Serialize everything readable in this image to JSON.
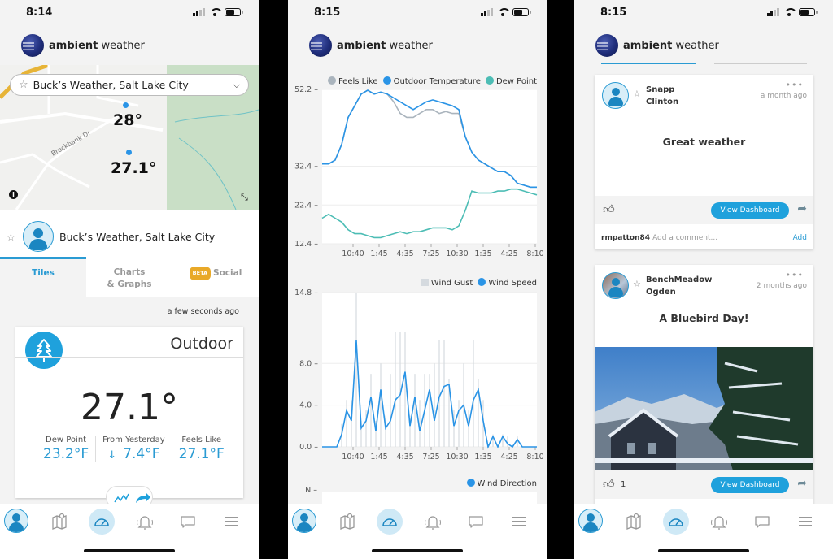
{
  "brand": {
    "bold": "ambient",
    "light": " weather"
  },
  "screens": [
    {
      "status_time": "8:14",
      "map": {
        "street_label": "Brockbank Dr",
        "pins": [
          {
            "temp": "28°"
          },
          {
            "temp": "27.1°"
          }
        ],
        "info_icon": "i",
        "expand_icon": "⤡"
      },
      "station_select": {
        "star_icon": "☆",
        "value": "Buck’s Weather, Salt Lake City",
        "chevron_icon": "⌄"
      },
      "owner": {
        "star_icon": "☆",
        "name": "Buck’s Weather, Salt Lake City"
      },
      "tabs": [
        {
          "label": "Tiles",
          "active": true
        },
        {
          "label_line1": "Charts",
          "label_line2": "& Graphs"
        },
        {
          "badge": "BETA",
          "label": "Social"
        }
      ],
      "updated": "a few seconds ago",
      "tile": {
        "title": "Outdoor",
        "temperature": "27.1°",
        "stats": [
          {
            "label": "Dew Point",
            "value": "23.2°F"
          },
          {
            "label": "From Yesterday",
            "arrow": "↓",
            "value": "7.4°F"
          },
          {
            "label": "Feels Like",
            "value": "27.1°F"
          }
        ]
      }
    },
    {
      "status_time": "8:15",
      "wind_direction_legend": "Wind Direction",
      "wind_direction_first_tick": "N"
    },
    {
      "status_time": "8:15",
      "posts": [
        {
          "user_line1": "Snapp",
          "user_line2": "Clinton",
          "time": "a month ago",
          "more": "•••",
          "message": "Great weather",
          "likes": "",
          "button": "View Dashboard",
          "comment_user": "rmpatton84",
          "comment_placeholder": "Add a comment...",
          "comment_add": "Add"
        },
        {
          "user_line1": "BenchMeadow",
          "user_line2": "Ogden",
          "time": "2 months ago",
          "more": "•••",
          "message": "A Bluebird Day!",
          "likes": "1",
          "button": "View Dashboard"
        }
      ]
    }
  ],
  "nav": [
    "profile",
    "map",
    "dashboard",
    "alerts",
    "messages",
    "menu"
  ],
  "colors": {
    "accent": "#1fa1dc",
    "temp_line": "#2a94e6",
    "dew_line": "#4dbdb5",
    "feels_line": "#aab4bd",
    "gust": "#d5dadf",
    "beta": "#e9a928"
  },
  "chart_data": [
    {
      "type": "line",
      "title": "",
      "legend": [
        "Feels Like",
        "Outdoor Temperature",
        "Dew Point"
      ],
      "legend_position": "top-right",
      "x_ticks": [
        "10:40",
        "1:45",
        "4:35",
        "7:25",
        "10:30",
        "1:35",
        "4:25",
        "8:10"
      ],
      "y_ticks": [
        "12.4",
        "22.4",
        "32.4",
        "52.2"
      ],
      "ylim": [
        12.4,
        52.2
      ],
      "grid": true,
      "series": [
        {
          "name": "Outdoor Temperature",
          "values": [
            33,
            33,
            34,
            38,
            45,
            48,
            51,
            52,
            51,
            51.5,
            51,
            50,
            49,
            48,
            47,
            48,
            49,
            49.5,
            49,
            48.5,
            48,
            47,
            40,
            36,
            34,
            33,
            32,
            31,
            31,
            30,
            28,
            27.5,
            27,
            27
          ]
        },
        {
          "name": "Feels Like",
          "values": [
            33,
            33,
            34,
            38,
            45,
            48,
            51,
            52,
            51,
            51.5,
            51,
            49,
            46,
            45,
            45,
            46,
            47,
            47,
            46,
            46.5,
            46,
            46,
            40,
            36,
            34,
            33,
            32,
            31,
            31,
            30,
            28,
            27.5,
            27,
            27
          ]
        },
        {
          "name": "Dew Point",
          "values": [
            19,
            20,
            19,
            18,
            16,
            15,
            15,
            14.5,
            14,
            14,
            14.5,
            15,
            15.5,
            15,
            15.5,
            15.5,
            16,
            16.5,
            16.5,
            16.5,
            16,
            17,
            21,
            26,
            25.5,
            25.5,
            25.5,
            26,
            26,
            26.5,
            26.5,
            26,
            25.5,
            25
          ]
        }
      ]
    },
    {
      "type": "bar",
      "title": "",
      "legend": [
        "Wind Gust",
        "Wind Speed"
      ],
      "legend_position": "top-right",
      "x_ticks": [
        "10:40",
        "1:45",
        "4:35",
        "7:25",
        "10:30",
        "1:35",
        "4:25",
        "8:10"
      ],
      "y_ticks": [
        "0.0",
        "4.0",
        "8.0",
        "14.8"
      ],
      "ylim": [
        0,
        14.8
      ],
      "grid": true,
      "series": [
        {
          "name": "Wind Speed",
          "values": [
            0,
            0,
            0,
            0,
            1.2,
            3.5,
            2.5,
            10.2,
            1.8,
            2.5,
            4.8,
            1.5,
            5.5,
            1.8,
            2.5,
            4.5,
            5,
            7.2,
            2,
            4.8,
            1.5,
            3.5,
            5.5,
            2.5,
            4.8,
            5.8,
            6,
            2,
            3.5,
            4,
            2,
            4.5,
            5.5,
            2.5,
            0,
            1,
            0,
            1,
            0.3,
            0,
            0.7,
            0,
            0,
            0,
            0
          ]
        },
        {
          "name": "Wind Gust",
          "values": [
            0,
            0,
            0,
            0,
            2.2,
            4.5,
            4.5,
            14.8,
            2.5,
            3.5,
            7,
            2.5,
            8,
            3,
            7,
            11,
            11,
            11,
            3,
            7,
            4.5,
            7,
            7,
            8,
            10.2,
            10.2,
            6.5,
            3.5,
            4.5,
            8,
            3.5,
            10.2,
            6.5,
            4.5,
            0,
            1.2,
            0,
            1.2,
            1,
            0,
            1,
            0,
            0,
            0,
            0
          ]
        }
      ]
    }
  ]
}
